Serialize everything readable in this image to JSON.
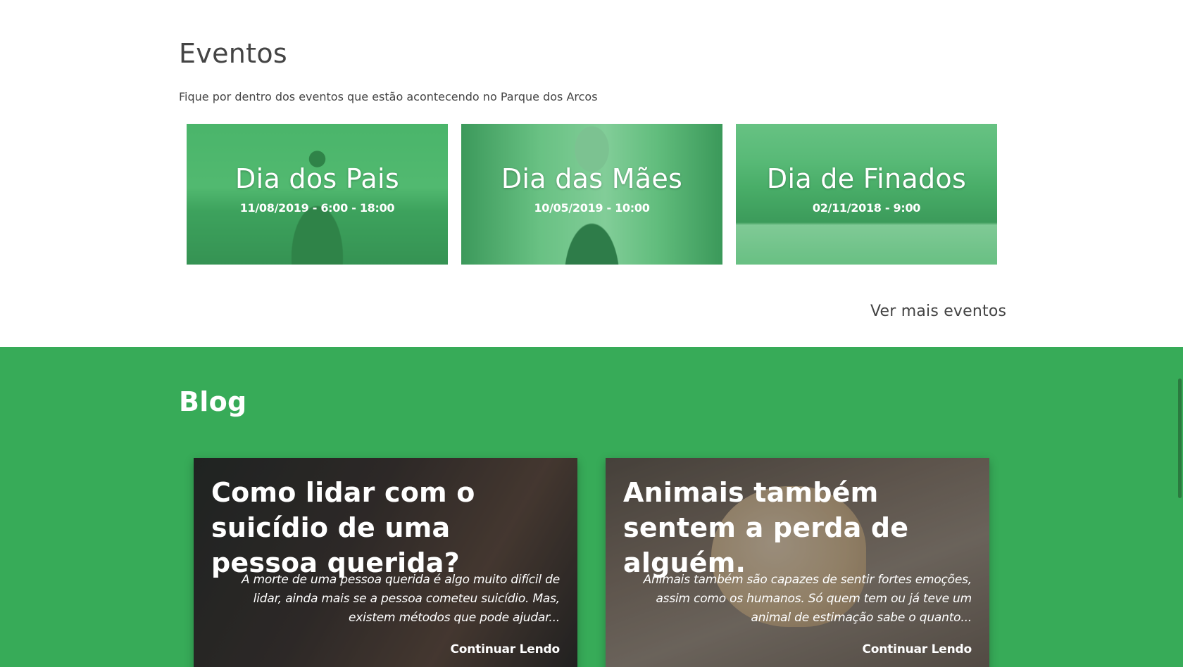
{
  "eventos": {
    "title": "Eventos",
    "subtitle": "Fique por dentro dos eventos que estão acontecendo no Parque dos Arcos",
    "items": [
      {
        "title": "Dia dos Pais",
        "date": "11/08/2019 - 6:00 - 18:00"
      },
      {
        "title": "Dia das Mães",
        "date": "10/05/2019 - 10:00"
      },
      {
        "title": "Dia de Finados",
        "date": "02/11/2018 - 9:00"
      }
    ],
    "more_label": "Ver mais eventos"
  },
  "blog": {
    "title": "Blog",
    "posts": [
      {
        "title": "Como lidar com o suicídio de uma pessoa querida?",
        "excerpt": "A morte de uma pessoa querida é algo muito difícil de lidar, ainda mais se a pessoa cometeu suicídio. Mas, existem métodos que pode ajudar...",
        "link_label": "Continuar Lendo"
      },
      {
        "title": "Animais também sentem a perda de alguém.",
        "excerpt": "Animais também são capazes de sentir fortes emoções, assim como os humanos. Só quem tem ou já teve um animal de estimação sabe o quanto...",
        "link_label": "Continuar Lendo"
      }
    ]
  },
  "colors": {
    "brand_green": "#37ab58",
    "event_overlay": "rgba(60,178,100,0.55)",
    "text_dark": "#444444"
  }
}
